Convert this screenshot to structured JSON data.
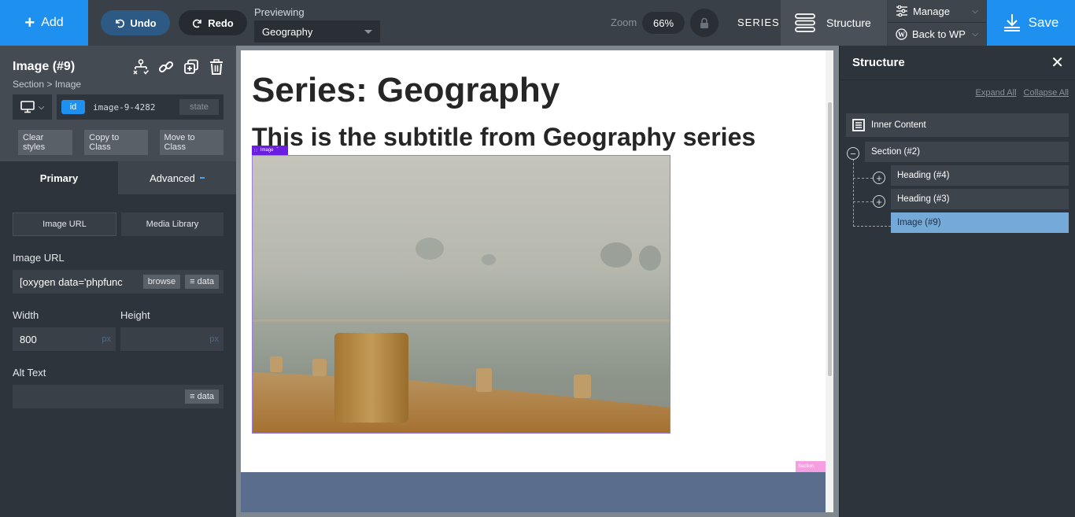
{
  "topbar": {
    "add_label": "Add",
    "undo_label": "Undo",
    "redo_label": "Redo",
    "previewing_label": "Previewing",
    "previewing_value": "Geography",
    "zoom_label": "Zoom",
    "zoom_value": "66%",
    "series_label": "SERIES",
    "structure_label": "Structure",
    "manage_label": "Manage",
    "back_label": "Back to WP",
    "save_label": "Save"
  },
  "left_panel": {
    "title": "Image (#9)",
    "breadcrumb": "Section > Image",
    "selector": {
      "tag": "id",
      "name": "image-9-4282",
      "state_label": "state"
    },
    "actions": [
      "Clear styles",
      "Copy to Class",
      "Move to Class"
    ],
    "tabs": {
      "primary": "Primary",
      "advanced": "Advanced"
    },
    "source_options": [
      "Image URL",
      "Media Library"
    ],
    "fields": {
      "image_url_label": "Image URL",
      "image_url_value": "[oxygen data='phpfunc",
      "browse_label": "browse",
      "data_label": "data",
      "width_label": "Width",
      "width_value": "800",
      "width_unit": "px",
      "height_label": "Height",
      "height_value": "",
      "height_unit": "px",
      "alt_label": "Alt Text",
      "alt_value": ""
    }
  },
  "canvas": {
    "heading1": "Series: Geography",
    "heading2": "This is the subtitle from Geography series",
    "image_badge": "Image",
    "section_badge": "Section"
  },
  "right_panel": {
    "title": "Structure",
    "expand_all": "Expand All",
    "collapse_all": "Collapse All",
    "tree": {
      "root": "Inner Content",
      "section": "Section (#2)",
      "children": [
        "Heading (#4)",
        "Heading (#3)",
        "Image (#9)"
      ]
    }
  },
  "colors": {
    "accent": "#1e90f0",
    "selected_tree": "#74a9d8",
    "image_outline": "#6a1ee0",
    "section_badge": "#f59fe0"
  }
}
